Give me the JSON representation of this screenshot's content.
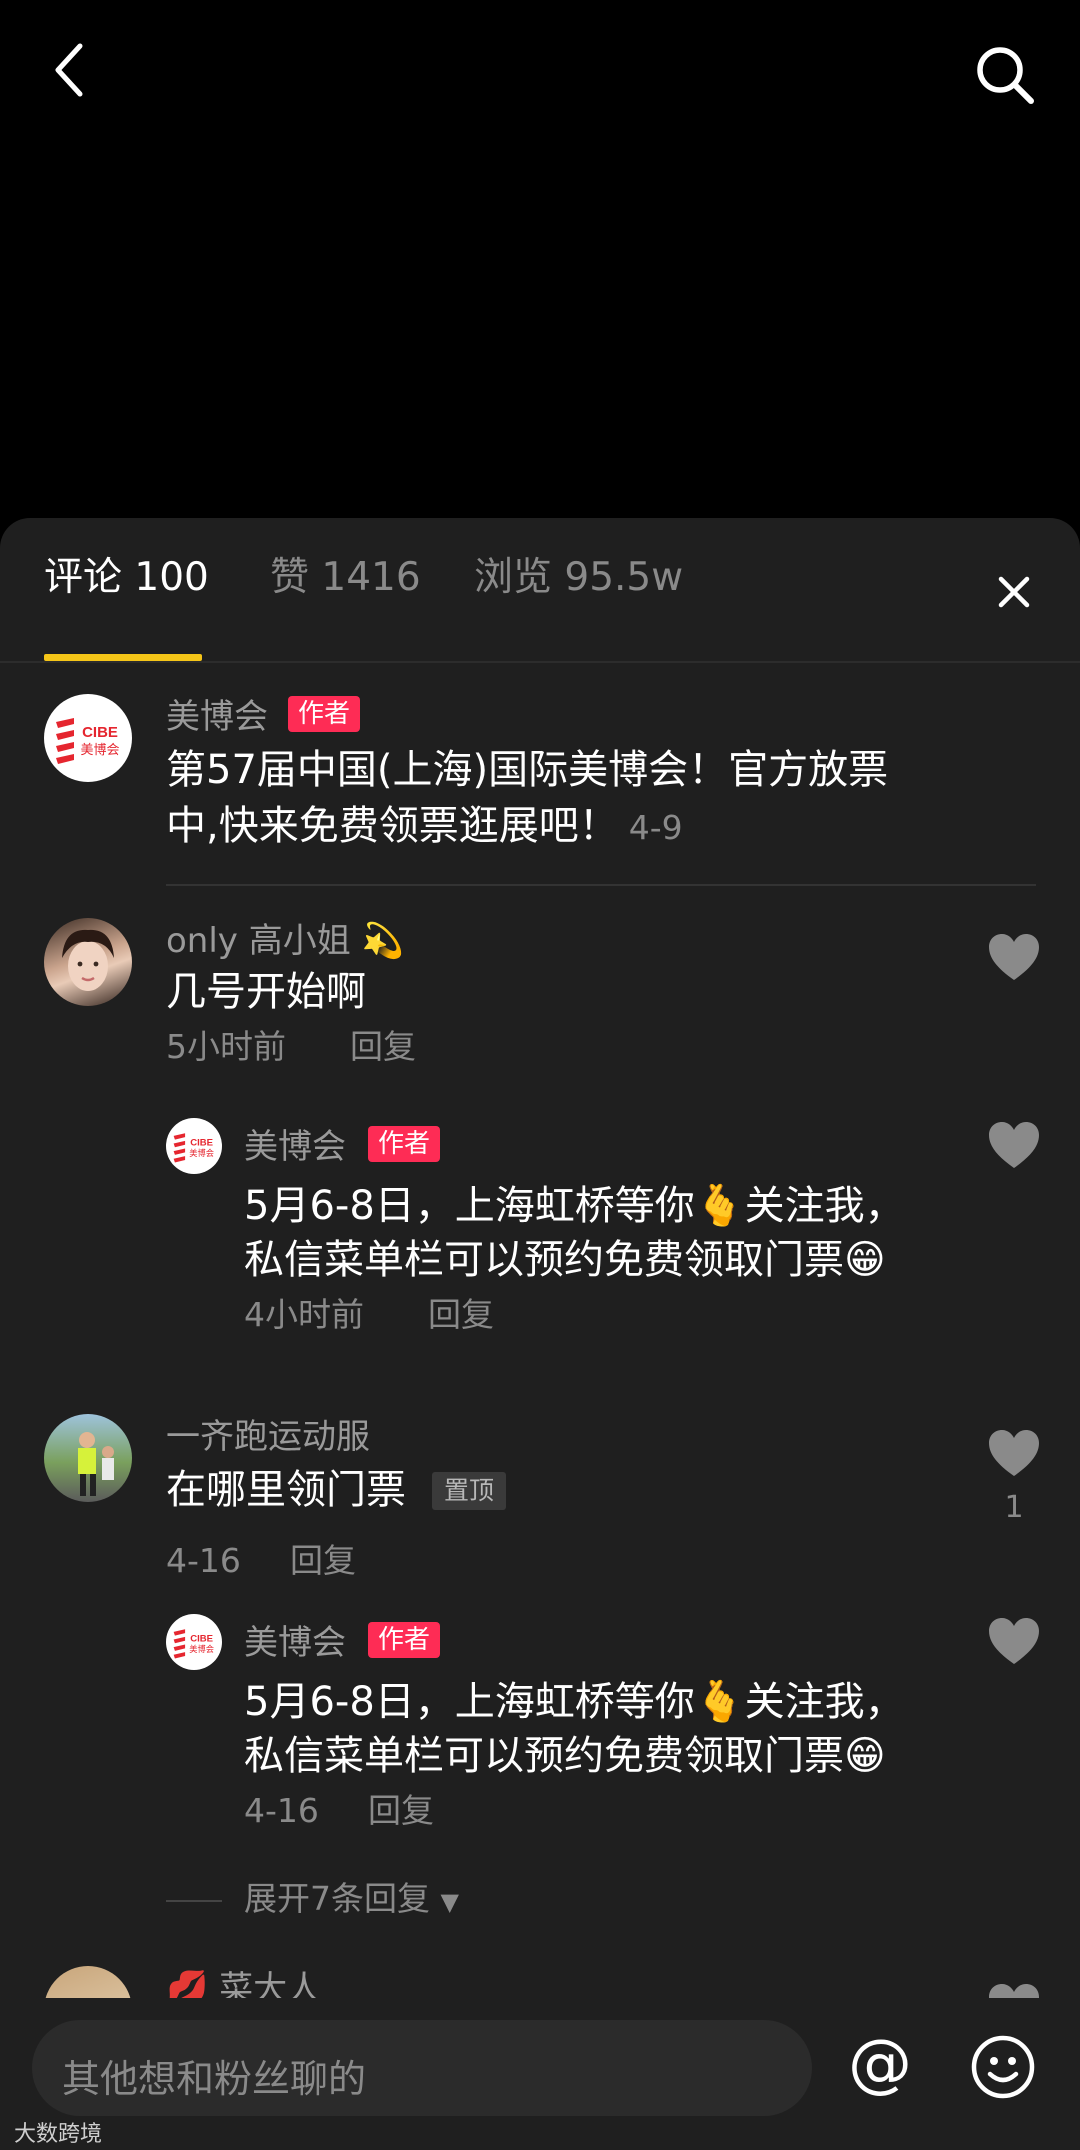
{
  "tabs": {
    "comments": "评论 100",
    "likes": "赞 1416",
    "views": "浏览 95.5w"
  },
  "author_post": {
    "username": "美博会",
    "badge": "作者",
    "text_line1": "第57届中国(上海)国际美博会！官方放票",
    "text_line2": "中,快来免费领票逛展吧！",
    "date": "4-9",
    "avatar_logo_line1": "CIBE",
    "avatar_logo_line2": "美博会"
  },
  "comments": [
    {
      "username": "only 高小姐",
      "username_emoji": "💫",
      "text": "几号开始啊",
      "time": "5小时前",
      "reply_label": "回复",
      "reply": {
        "username": "美博会",
        "badge": "作者",
        "text_line1": "5月6-8日，上海虹桥等你🫰关注我，",
        "text_line2": "私信菜单栏可以预约免费领取门票😁",
        "time": "4小时前",
        "reply_label": "回复"
      }
    },
    {
      "username": "一齐跑运动服",
      "text": "在哪里领门票",
      "pinned_label": "置顶",
      "time": "4-16",
      "reply_label": "回复",
      "like_count": "1",
      "reply": {
        "username": "美博会",
        "badge": "作者",
        "text_line1": "5月6-8日，上海虹桥等你🫰关注我，",
        "text_line2": "私信菜单栏可以预约免费领取门票😁",
        "time": "4-16",
        "reply_label": "回复"
      },
      "expand_label": "展开7条回复"
    },
    {
      "username": "菜大人",
      "username_emoji": "💋"
    }
  ],
  "input": {
    "placeholder": "其他想和粉丝聊的"
  },
  "watermark": "大数跨境"
}
